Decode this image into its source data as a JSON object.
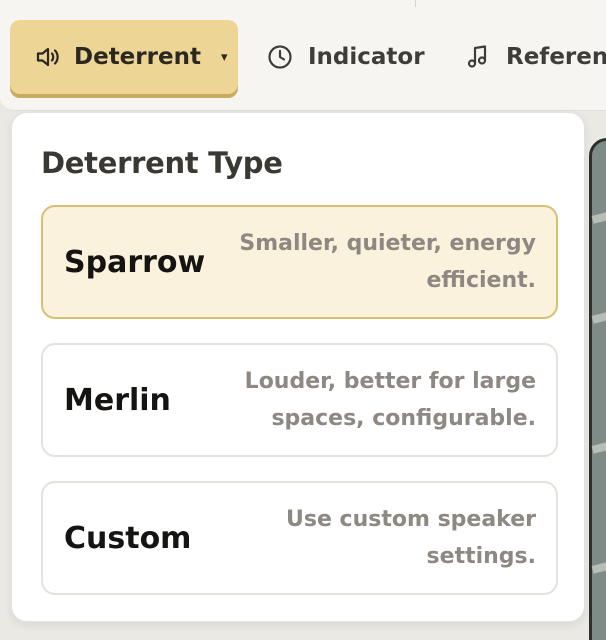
{
  "toolbar": {
    "tabs": [
      {
        "label": "Deterrent",
        "icon": "speaker-icon",
        "active": true,
        "has_dropdown": true
      },
      {
        "label": "Indicator",
        "icon": "clock-icon",
        "active": false
      },
      {
        "label": "Reference",
        "icon": "music-note-icon",
        "active": false
      }
    ],
    "dropdown_caret": "▾"
  },
  "dropdown": {
    "title": "Deterrent Type",
    "options": [
      {
        "name": "Sparrow",
        "description": "Smaller, quieter, energy efficient.",
        "selected": true
      },
      {
        "name": "Merlin",
        "description": "Louder, better for large spaces, configurable.",
        "selected": false
      },
      {
        "name": "Custom",
        "description": "Use custom speaker settings.",
        "selected": false
      }
    ]
  },
  "colors": {
    "active_tab": "#ecd595",
    "active_tab_shadow": "#c8ac5d",
    "selected_option_bg": "#faf2dc",
    "selected_option_border": "#d8bf72",
    "description_text": "#8d8881"
  }
}
